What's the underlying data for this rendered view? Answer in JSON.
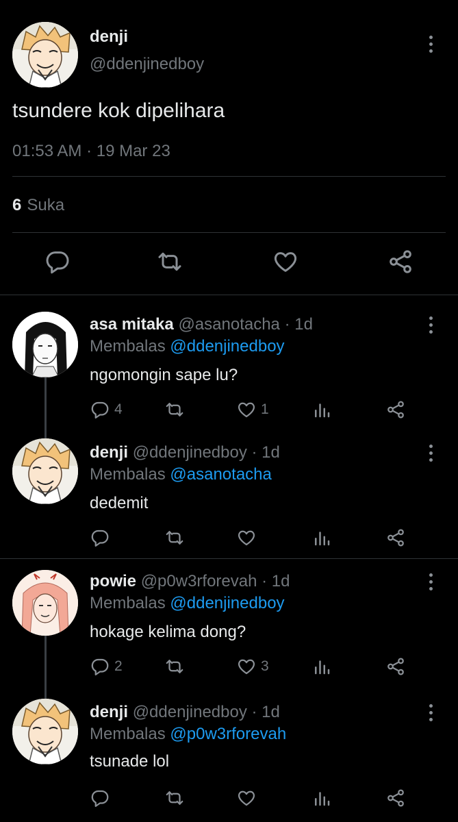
{
  "main_tweet": {
    "name": "denji",
    "handle": "@ddenjinedboy",
    "text": "tsundere kok dipelihara",
    "timestamp": "01:53 AM · 19 Mar 23",
    "likes_count": "6",
    "likes_label": "Suka",
    "actions": [
      "reply-icon",
      "retweet-icon",
      "like-icon",
      "share-icon"
    ]
  },
  "replies": [
    {
      "name": "asa mitaka",
      "handle": "@asanotacha",
      "age": "· 1d",
      "replying_prefix": "Membalas",
      "replying_to": "@ddenjinedboy",
      "text": "ngomongin sape lu?",
      "reply_count": "4",
      "retweet_count": "",
      "like_count": "1"
    },
    {
      "name": "denji",
      "handle": "@ddenjinedboy",
      "age": "· 1d",
      "replying_prefix": "Membalas",
      "replying_to": "@asanotacha",
      "text": "dedemit",
      "reply_count": "",
      "retweet_count": "",
      "like_count": ""
    },
    {
      "name": "powie",
      "handle": "@p0w3rforevah",
      "age": "· 1d",
      "replying_prefix": "Membalas",
      "replying_to": "@ddenjinedboy",
      "text": "hokage kelima dong?",
      "reply_count": "2",
      "retweet_count": "",
      "like_count": "3"
    },
    {
      "name": "denji",
      "handle": "@ddenjinedboy",
      "age": "· 1d",
      "replying_prefix": "Membalas",
      "replying_to": "@p0w3rforevah",
      "text": "tsunade lol",
      "reply_count": "",
      "retweet_count": "",
      "like_count": ""
    }
  ],
  "colors": {
    "background": "#000000",
    "text": "#e7e9ea",
    "muted": "#71767b",
    "link": "#1d9bf0",
    "divider": "#2f3336"
  }
}
